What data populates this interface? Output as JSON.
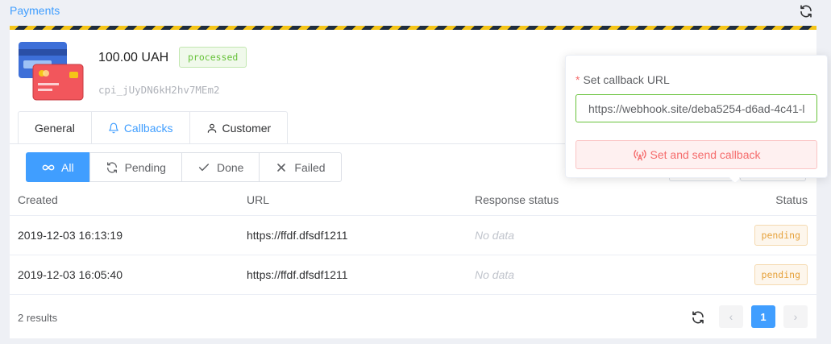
{
  "header": {
    "title": "Payments"
  },
  "payment": {
    "amount": "100.00 UAH",
    "status": "processed",
    "id": "cpi_jUyDN6kH2hv7MEm2"
  },
  "tabs": [
    {
      "label": "General",
      "icon": "none",
      "active": false
    },
    {
      "label": "Callbacks",
      "icon": "bell-icon",
      "active": true
    },
    {
      "label": "Customer",
      "icon": "user-icon",
      "active": false
    }
  ],
  "filters": [
    {
      "label": "All",
      "icon": "infinity-icon",
      "active": true
    },
    {
      "label": "Pending",
      "icon": "refresh-icon",
      "active": false
    },
    {
      "label": "Done",
      "icon": "check-icon",
      "active": false
    },
    {
      "label": "Failed",
      "icon": "close-icon",
      "active": false
    }
  ],
  "table": {
    "columns": [
      "Created",
      "URL",
      "Response status",
      "Status"
    ],
    "rows": [
      {
        "created": "2019-12-03 16:13:19",
        "url": "https://ffdf.dfsdf1211",
        "response": "No data",
        "status": "pending"
      },
      {
        "created": "2019-12-03 16:05:40",
        "url": "https://ffdf.dfsdf1211",
        "response": "No data",
        "status": "pending"
      }
    ],
    "results": "2 results"
  },
  "pagination": {
    "current": "1",
    "prev": "‹",
    "next": "›"
  },
  "popover": {
    "required_mark": "*",
    "label": "Set callback URL",
    "url_value": "https://webhook.site/deba5254-d6ad-4c41-l",
    "button_label": "Set and send callback"
  },
  "colors": {
    "primary": "#409eff",
    "success": "#67c23a",
    "warning": "#e6a23c",
    "danger": "#f56c6c"
  }
}
